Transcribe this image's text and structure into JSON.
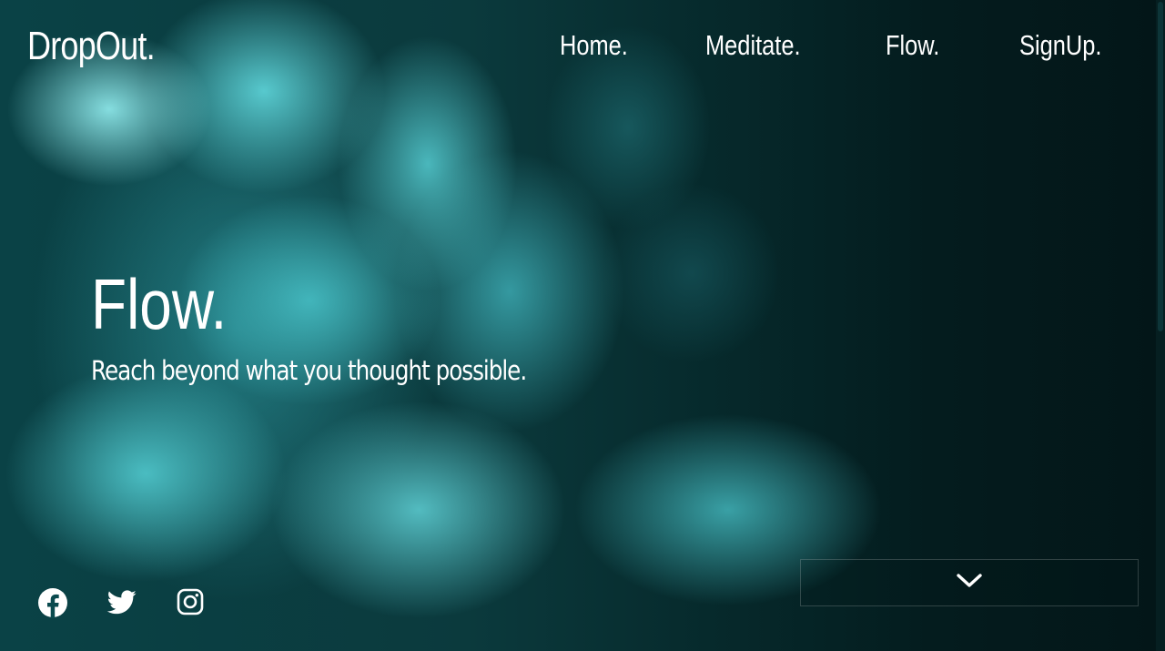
{
  "brand": {
    "logo_text": "DropOut."
  },
  "nav": {
    "items": [
      {
        "label": "Home."
      },
      {
        "label": "Meditate."
      },
      {
        "label": "Flow."
      },
      {
        "label": "SignUp."
      }
    ]
  },
  "hero": {
    "title": "Flow.",
    "subtitle": "Reach beyond what you thought possible."
  },
  "social": [
    {
      "icon": "facebook-icon"
    },
    {
      "icon": "twitter-icon"
    },
    {
      "icon": "instagram-icon"
    }
  ],
  "scroll_button": {
    "icon": "chevron-down-icon"
  },
  "colors": {
    "text": "#ffffff",
    "background_dark": "#031a1c",
    "smoke_teal": "#5fd7dc"
  }
}
